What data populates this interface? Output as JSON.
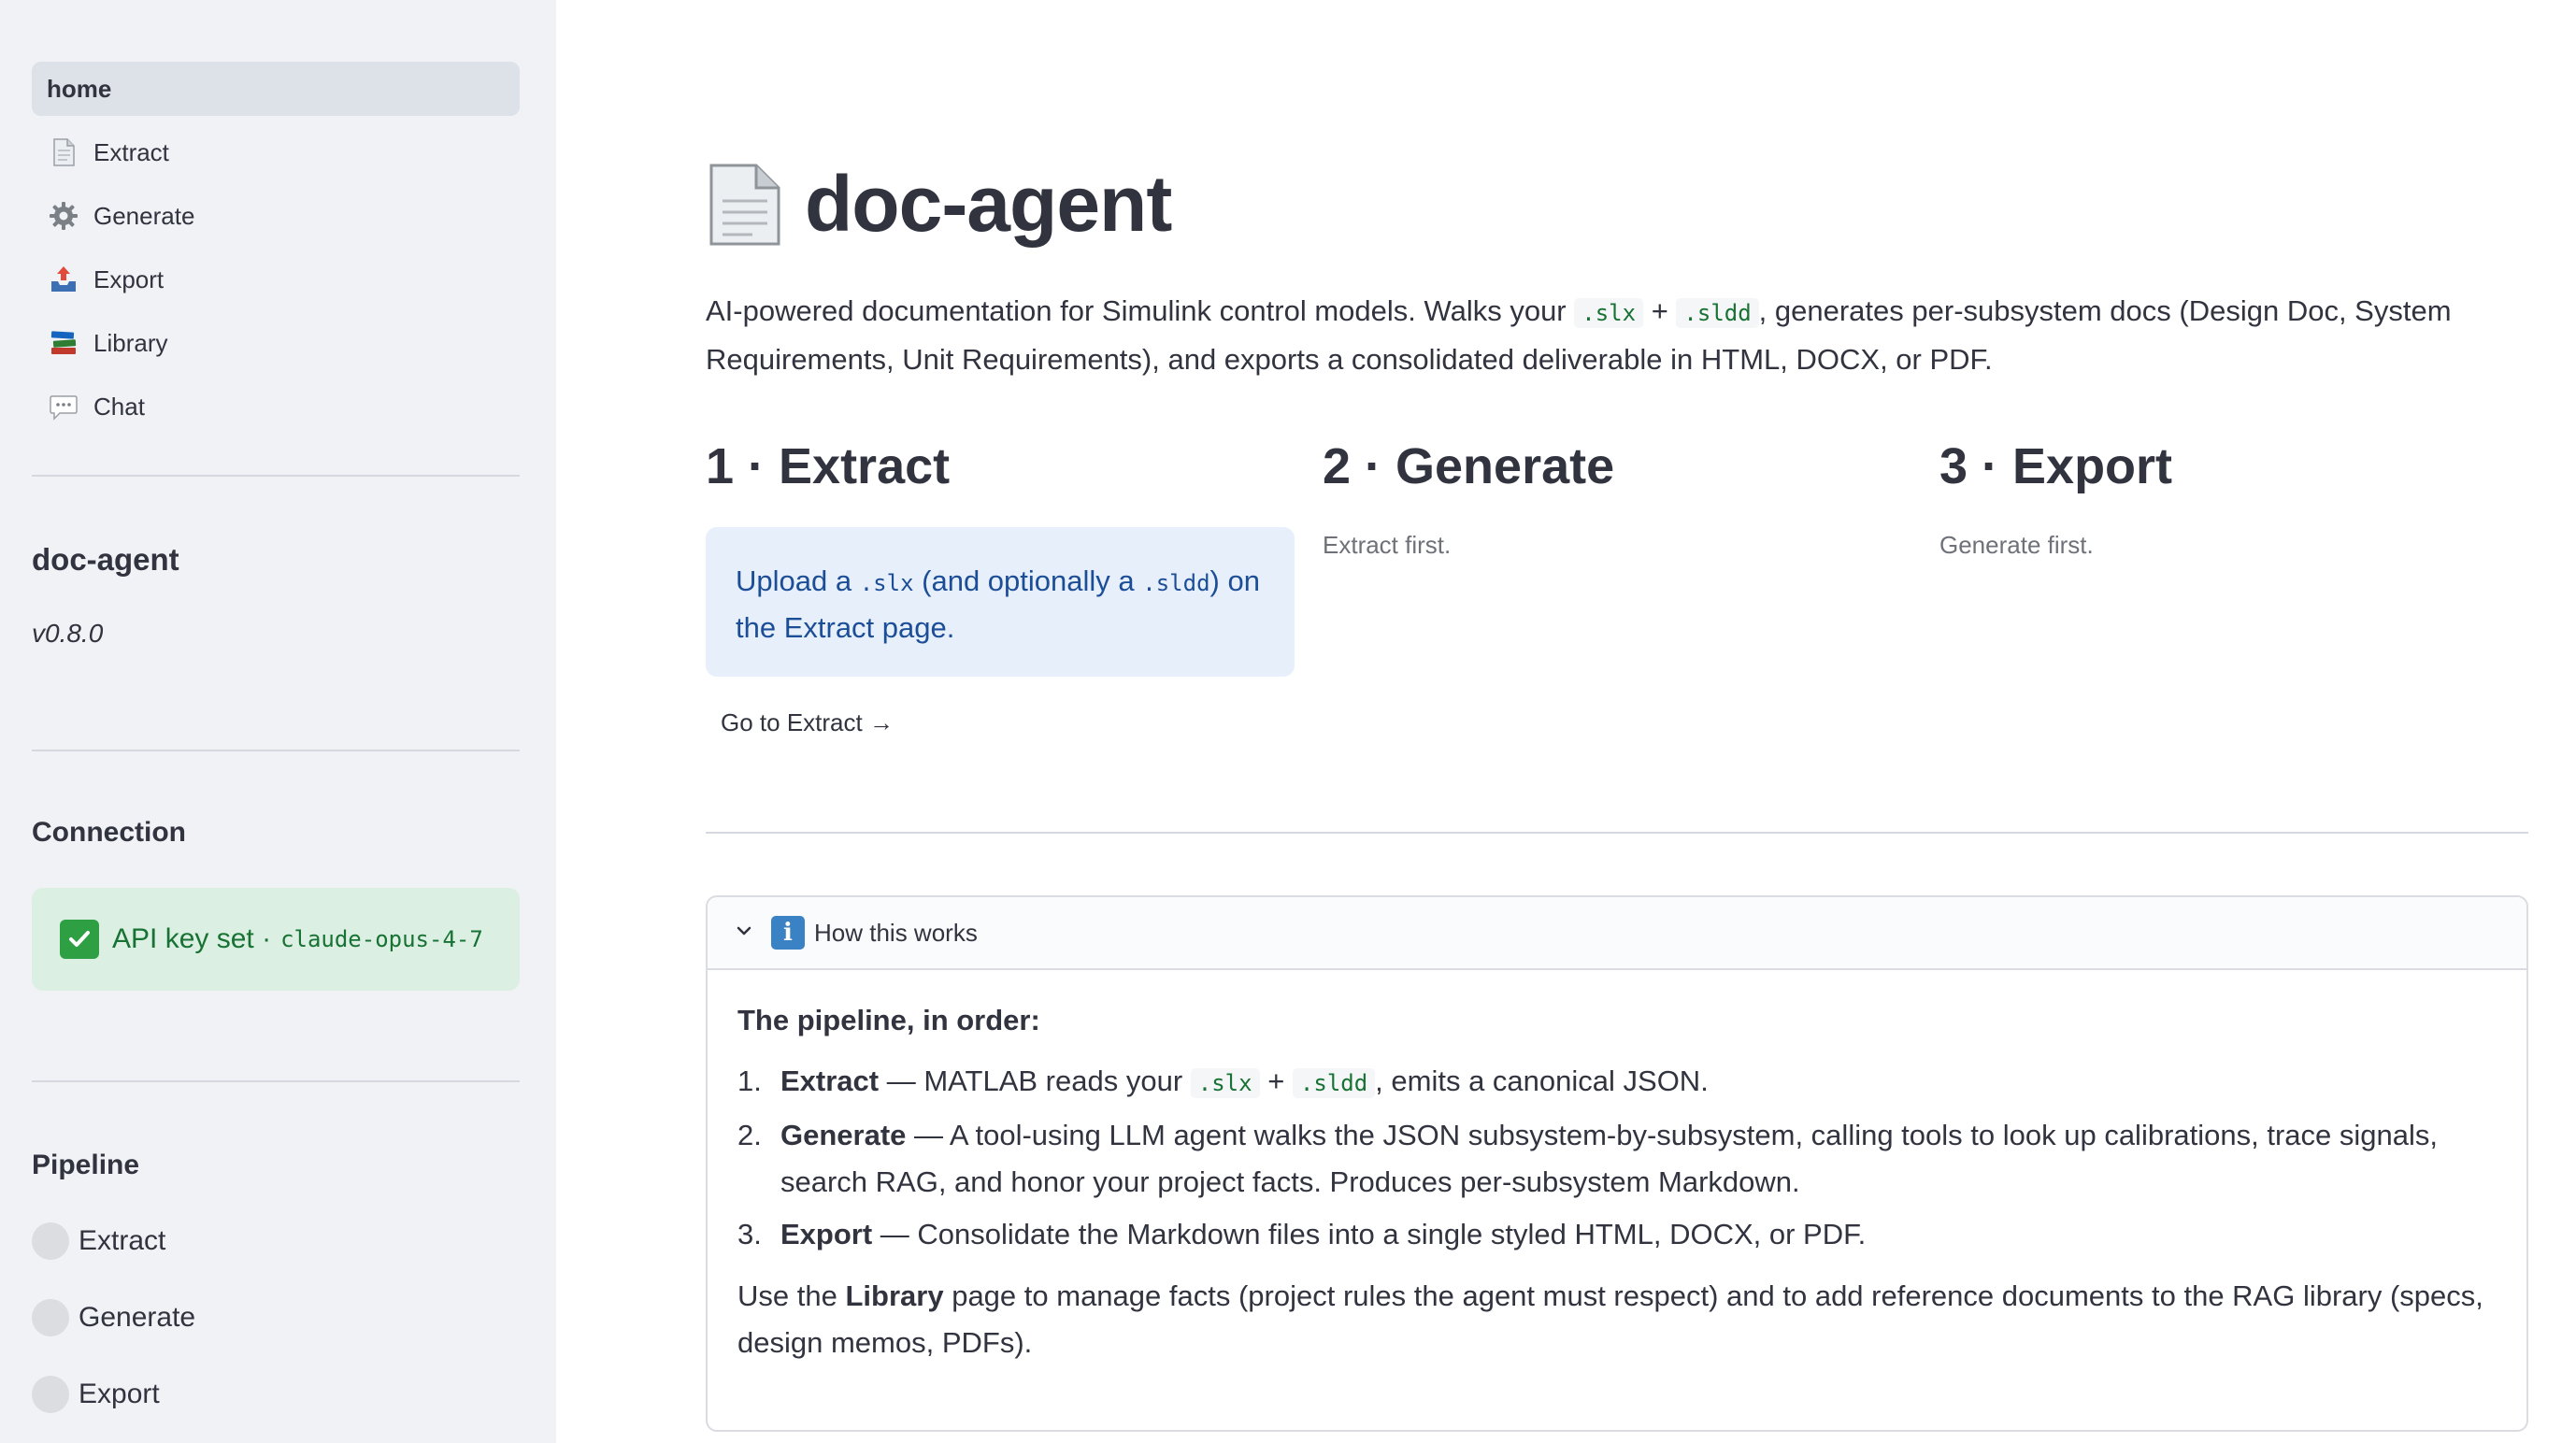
{
  "sidebar": {
    "nav": [
      {
        "label": "home",
        "icon": "none",
        "active": true
      },
      {
        "label": "Extract",
        "icon": "page-icon"
      },
      {
        "label": "Generate",
        "icon": "gear-icon"
      },
      {
        "label": "Export",
        "icon": "outbox-tray-icon"
      },
      {
        "label": "Library",
        "icon": "books-icon"
      },
      {
        "label": "Chat",
        "icon": "speech-balloon-icon"
      }
    ],
    "app_name": "doc-agent",
    "version": "v0.8.0",
    "connection": {
      "title": "Connection",
      "status_text": "API key set ·",
      "model": "claude-opus-4-7"
    },
    "pipeline": {
      "title": "Pipeline",
      "steps": [
        "Extract",
        "Generate",
        "Export"
      ]
    }
  },
  "main": {
    "title": "doc-agent",
    "intro": {
      "part1": "AI-powered documentation for Simulink control models. Walks your",
      "ext1": ".slx",
      "plus": "+",
      "ext2": ".sldd",
      "part2": ", generates per-subsystem docs (Design Doc, System Requirements, Unit Requirements), and exports a consolidated deliverable in HTML, DOCX, or PDF."
    },
    "steps": [
      {
        "title": "1 · Extract"
      },
      {
        "title": "2 · Generate",
        "note": "Extract first."
      },
      {
        "title": "3 · Export",
        "note": "Generate first."
      }
    ],
    "info_box": {
      "t1": "Upload a",
      "c1": ".slx",
      "t2": "(and optionally a",
      "c2": ".sldd",
      "t3": ") on the Extract page."
    },
    "goto_link": "Go to Extract →",
    "expander": {
      "title": "How this works",
      "lead": "The pipeline, in order:",
      "items": [
        {
          "num": "1.",
          "bold": "Extract",
          "pre": " — MATLAB reads your",
          "c1": ".slx",
          "plus": "+",
          "c2": ".sldd",
          "post": ", emits a canonical JSON."
        },
        {
          "num": "2.",
          "bold": "Generate",
          "text": " — A tool-using LLM agent walks the JSON subsystem-by-subsystem, calling tools to look up calibrations, trace signals, search RAG, and honor your project facts. Produces per-subsystem Markdown."
        },
        {
          "num": "3.",
          "bold": "Export",
          "text": " — Consolidate the Markdown files into a single styled HTML, DOCX, or PDF."
        }
      ],
      "outro_pre": "Use the",
      "outro_bold": "Library",
      "outro_post": "page to manage facts (project rules the agent must respect) and to add reference documents to the RAG library (specs, design memos, PDFs)."
    }
  }
}
